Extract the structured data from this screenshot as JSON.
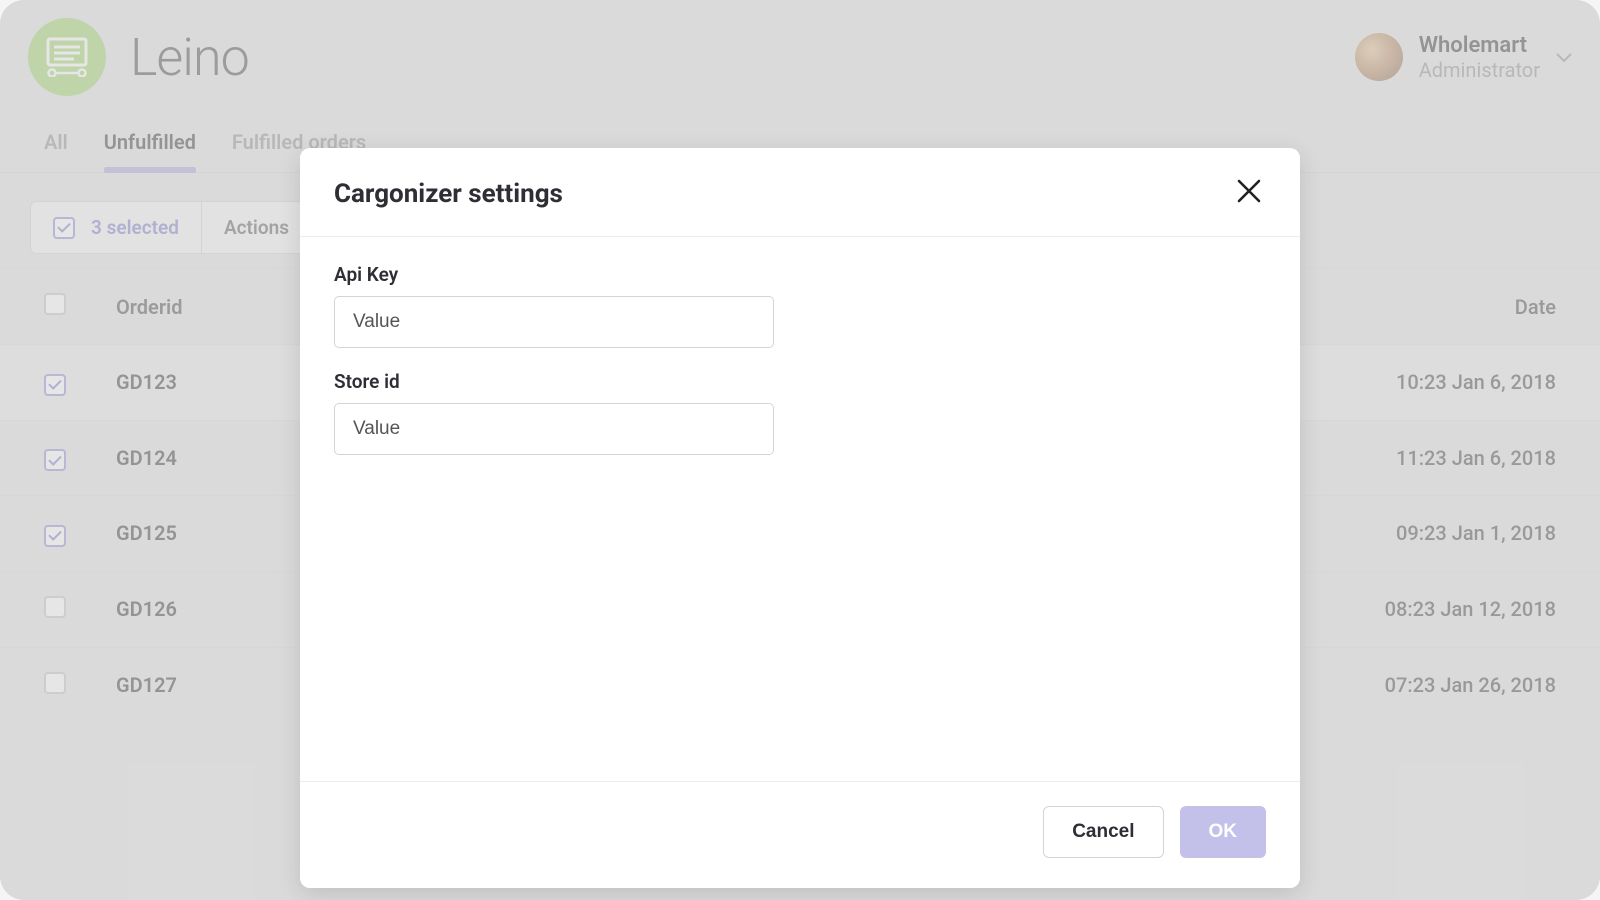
{
  "brand": {
    "name": "Leino"
  },
  "user": {
    "name": "Wholemart",
    "role": "Administrator"
  },
  "tabs": {
    "items": [
      {
        "label": "All",
        "active": false
      },
      {
        "label": "Unfulfilled",
        "active": true
      },
      {
        "label": "Fulfilled orders",
        "active": false
      }
    ]
  },
  "toolbar": {
    "selected_label": "3 selected",
    "actions_label": "Actions"
  },
  "table": {
    "columns": {
      "orderid": "Orderid",
      "date": "Date"
    },
    "rows": [
      {
        "id": "GD123",
        "date": "10:23 Jan 6, 2018",
        "checked": true
      },
      {
        "id": "GD124",
        "date": "11:23 Jan 6, 2018",
        "checked": true
      },
      {
        "id": "GD125",
        "date": "09:23 Jan 1, 2018",
        "checked": true
      },
      {
        "id": "GD126",
        "date": "08:23 Jan 12, 2018",
        "checked": false
      },
      {
        "id": "GD127",
        "date": "07:23 Jan 26, 2018",
        "checked": false
      }
    ]
  },
  "modal": {
    "title": "Cargonizer settings",
    "fields": {
      "apikey": {
        "label": "Api Key",
        "placeholder": "Value",
        "value": ""
      },
      "storeid": {
        "label": "Store id",
        "placeholder": "Value",
        "value": ""
      }
    },
    "buttons": {
      "cancel": "Cancel",
      "ok": "OK"
    }
  }
}
